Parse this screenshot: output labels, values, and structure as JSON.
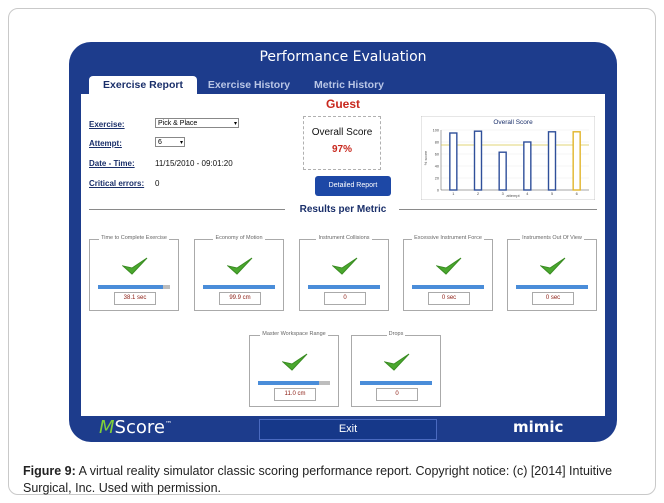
{
  "window": {
    "title": "Performance  Evaluation"
  },
  "tabs": [
    {
      "label": "Exercise Report",
      "active": true
    },
    {
      "label": "Exercise History",
      "active": false
    },
    {
      "label": "Metric History",
      "active": false
    }
  ],
  "user": {
    "name": "Guest"
  },
  "exercise_info": {
    "exercise_label": "Exercise:",
    "exercise_value": "Pick & Place",
    "attempt_label": "Attempt:",
    "attempt_value": "6",
    "datetime_label": "Date - Time:",
    "datetime_value": "11/15/2010  -  09:01:20",
    "errors_label": "Critical errors:",
    "errors_value": "0"
  },
  "overall": {
    "title": "Overall Score",
    "value": "97%",
    "detail_button": "Detailed Report"
  },
  "section": {
    "results_title": "Results per Metric"
  },
  "metrics": [
    {
      "name": "Time to Complete Exercise",
      "value": "38.1 sec",
      "fill": 0.9
    },
    {
      "name": "Economy of Motion",
      "value": "99.9 cm",
      "fill": 1.0
    },
    {
      "name": "Instrument Collisions",
      "value": "0",
      "fill": 1.0
    },
    {
      "name": "Excessive Instrument Force",
      "value": "0 sec",
      "fill": 1.0
    },
    {
      "name": "Instruments Out Of View",
      "value": "0 sec",
      "fill": 1.0
    },
    {
      "name": "Master Workspace Range",
      "value": "11.0 cm",
      "fill": 0.85
    },
    {
      "name": "Drops",
      "value": "0",
      "fill": 1.0
    }
  ],
  "chart_data": {
    "type": "bar",
    "title": "Overall Score",
    "xlabel": "attempt",
    "ylabel": "% score",
    "categories": [
      "1",
      "2",
      "3",
      "4",
      "5",
      "6"
    ],
    "values": [
      95,
      98,
      63,
      80,
      97,
      97
    ],
    "highlight_index": 5,
    "ylim": [
      0,
      100
    ],
    "yticks": [
      "0",
      "20",
      "40",
      "60",
      "80",
      "100"
    ],
    "colors": {
      "normal": "#2f4f9a",
      "highlight": "#e1b52a",
      "threshold_line": "#d8c84a"
    }
  },
  "bottom": {
    "brand_m": "M",
    "brand_rest": "Score",
    "brand_tm": "™",
    "exit_label": "Exit",
    "mimic_logo": "mimic"
  },
  "caption": {
    "lead": "Figure 9:",
    "text": " A virtual reality simulator classic scoring performance report. Copyright notice: (c) [2014] Intuitive Surgical, Inc. Used with permission."
  }
}
